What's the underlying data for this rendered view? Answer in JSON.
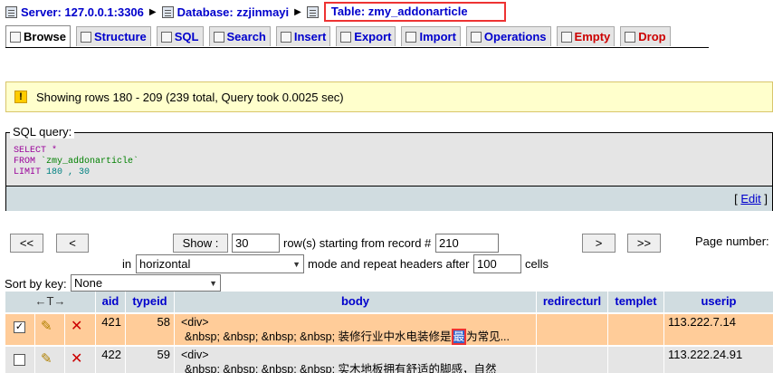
{
  "breadcrumb": {
    "server": "Server: 127.0.0.1:3306",
    "database": "Database: zzjinmayi",
    "table": "Table: zmy_addonarticle"
  },
  "tabs": [
    {
      "label": "Browse",
      "icon": "browse-icon"
    },
    {
      "label": "Structure",
      "icon": "structure-icon"
    },
    {
      "label": "SQL",
      "icon": "sql-icon"
    },
    {
      "label": "Search",
      "icon": "search-icon"
    },
    {
      "label": "Insert",
      "icon": "insert-icon"
    },
    {
      "label": "Export",
      "icon": "export-icon"
    },
    {
      "label": "Import",
      "icon": "import-icon"
    },
    {
      "label": "Operations",
      "icon": "operations-icon"
    },
    {
      "label": "Empty",
      "icon": "empty-icon"
    },
    {
      "label": "Drop",
      "icon": "drop-icon"
    }
  ],
  "notice": "Showing rows 180 - 209 (239 total, Query took 0.0025 sec)",
  "sql": {
    "legend": "SQL query:",
    "select_kw": "SELECT",
    "star": " *",
    "from_kw": "FROM",
    "table": " `zmy_addonarticle`",
    "limit_kw": "LIMIT",
    "limit_vals": " 180 , 30",
    "edit_open": "[ ",
    "edit_link": "Edit",
    "edit_close": " ]"
  },
  "nav": {
    "first": "<<",
    "prev": "<",
    "show": "Show :",
    "rows": "30",
    "rows_text": "row(s) starting from record #",
    "start": "210",
    "next": ">",
    "last": ">>",
    "page_number": "Page number:",
    "in": "in",
    "mode": "horizontal",
    "mode_text": "mode and repeat headers after",
    "repeat": "100",
    "cells": "cells"
  },
  "sort": {
    "label": "Sort by key:",
    "value": "None"
  },
  "table": {
    "headers": {
      "aid": "aid",
      "typeid": "typeid",
      "body": "body",
      "redirecturl": "redirecturl",
      "templet": "templet",
      "userip": "userip"
    },
    "rows": [
      {
        "checked": "✓",
        "aid": "421",
        "typeid": "58",
        "body_line1": "<div>",
        "body_line2a": "&nbsp; &nbsp; &nbsp; &nbsp; 装修行业中水电装修是",
        "body_mark": "最",
        "body_line2b": "为常见...",
        "userip": "113.222.7.14"
      },
      {
        "checked": "",
        "aid": "422",
        "typeid": "59",
        "body_line1": "<div>",
        "body_line2a": "&nbsp; &nbsp; &nbsp; &nbsp; 实木地板拥有舒适的脚感，自然",
        "body_mark": "",
        "body_line2b": "",
        "userip": "113.222.24.91"
      }
    ]
  }
}
